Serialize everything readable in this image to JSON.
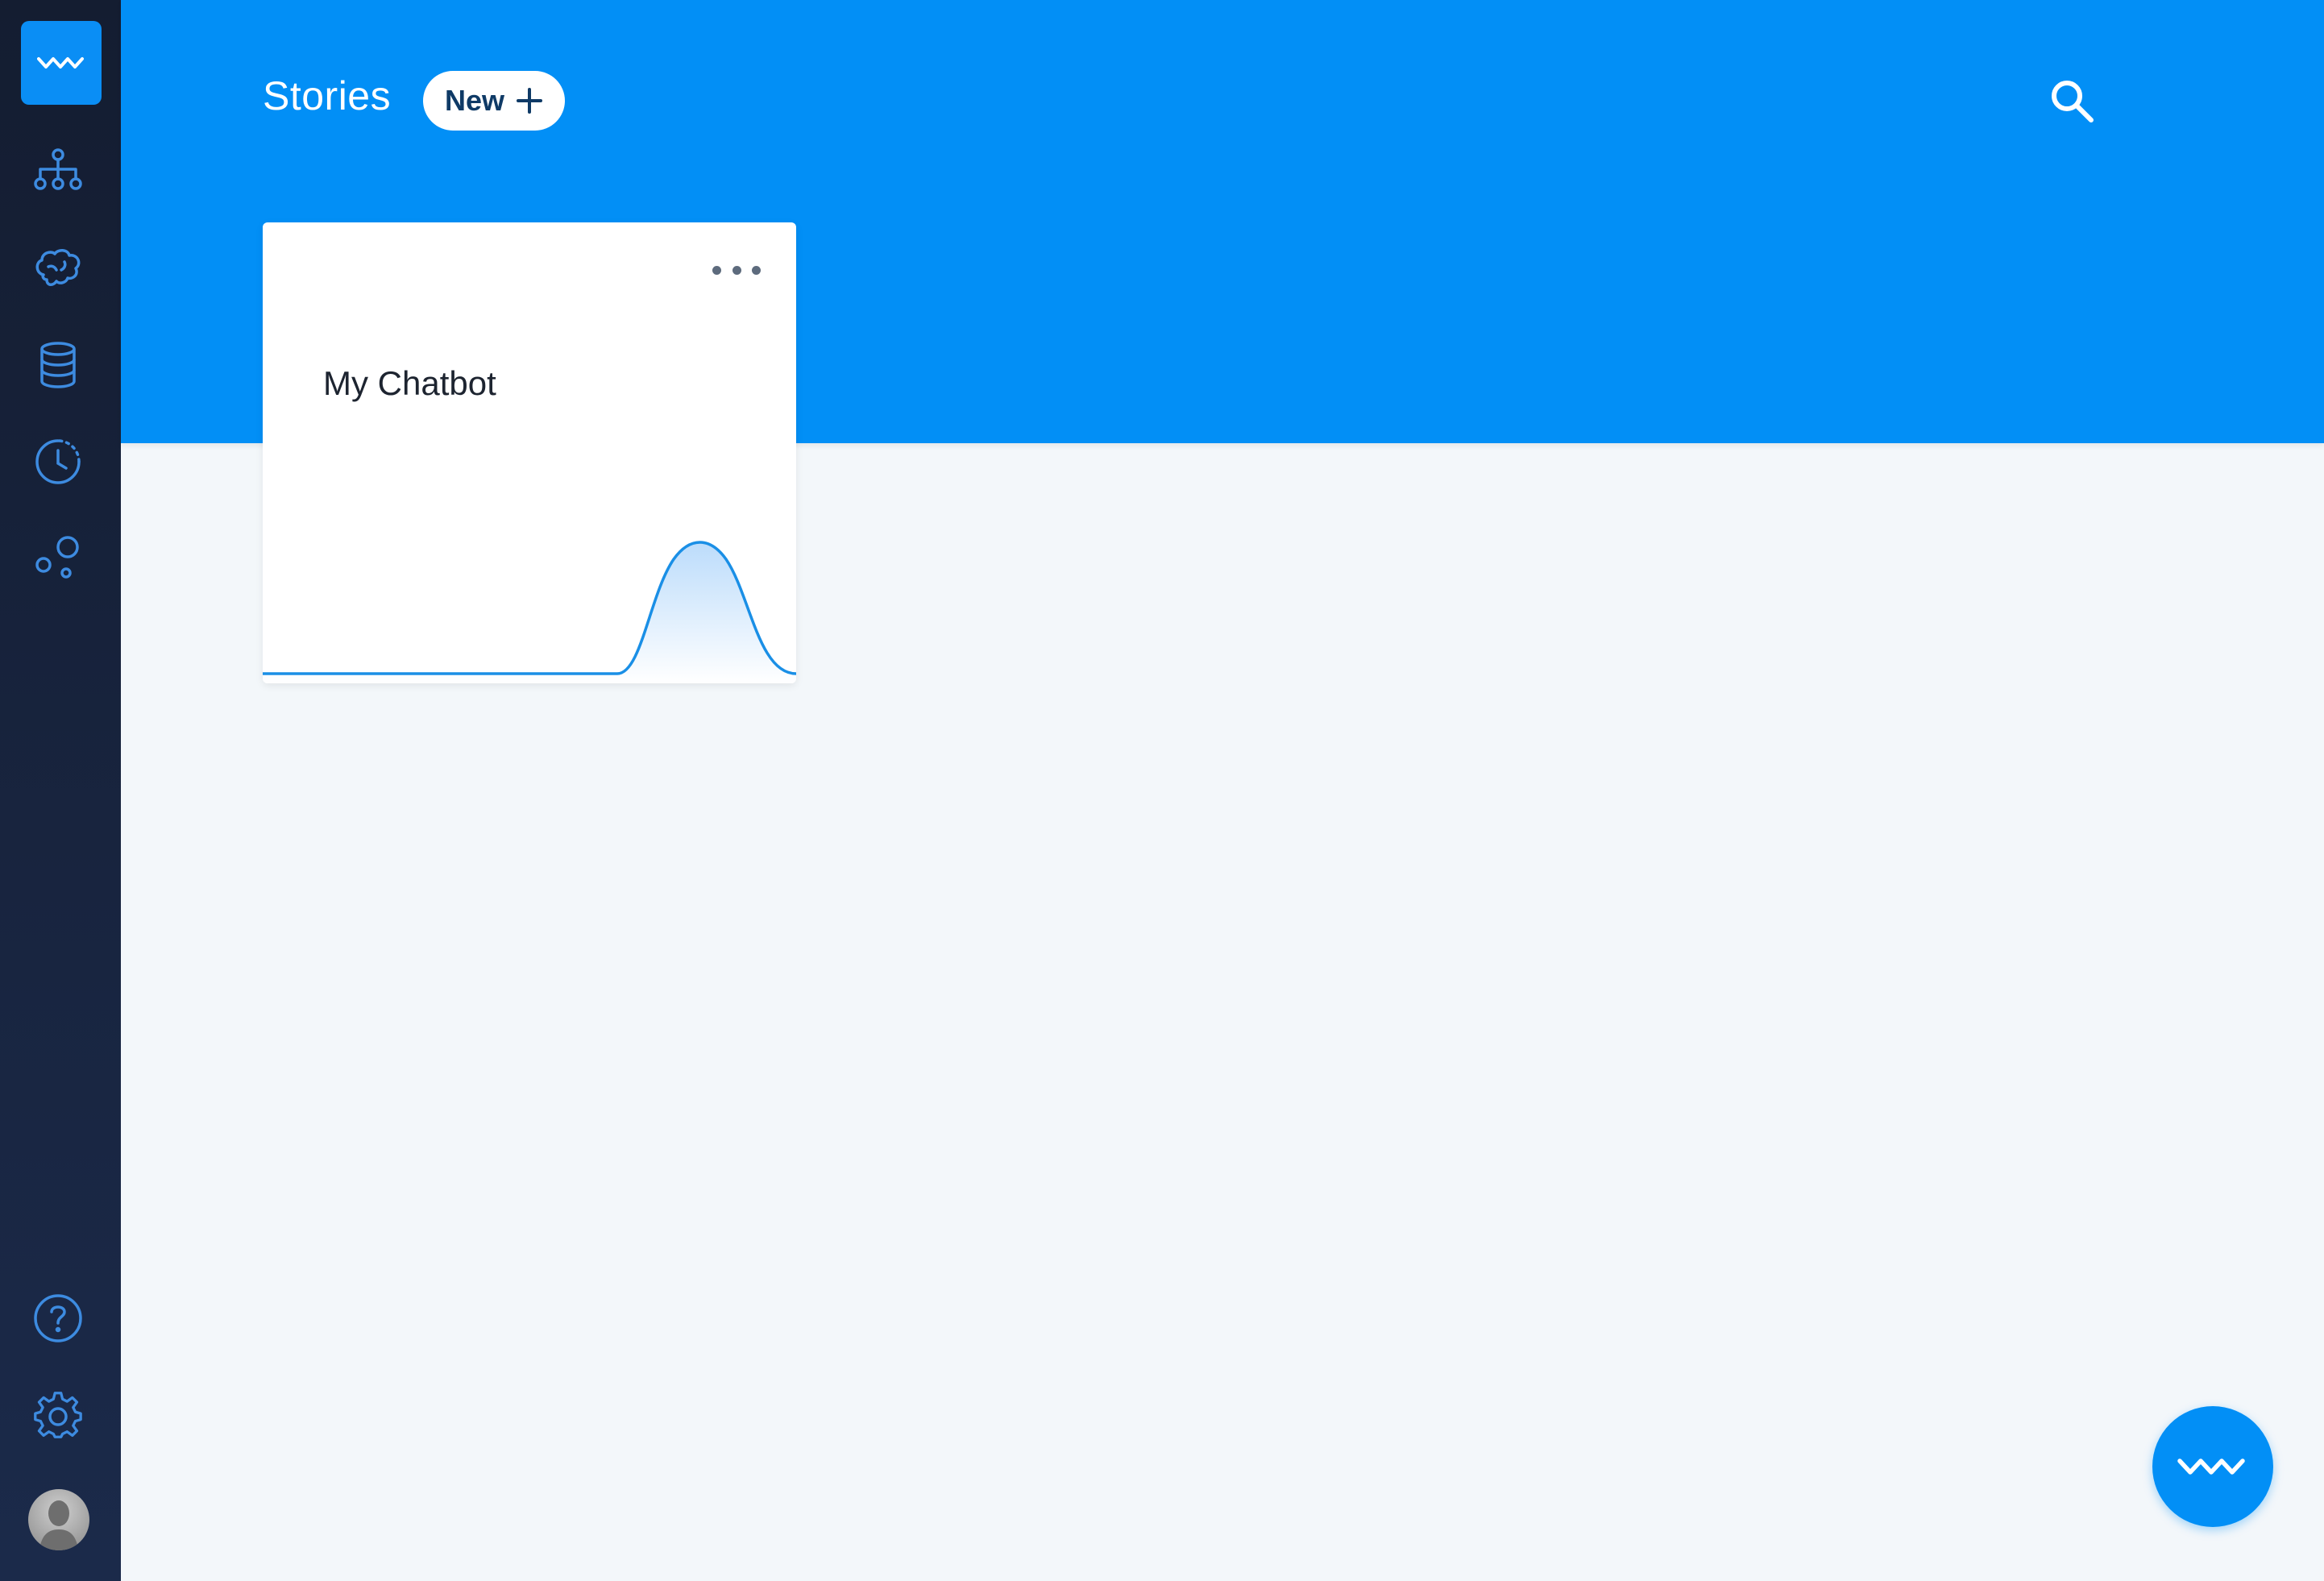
{
  "sidebar": {
    "logo_icon": "wave-logo-icon",
    "items": [
      {
        "icon": "sitemap-icon"
      },
      {
        "icon": "brain-icon"
      },
      {
        "icon": "database-icon"
      },
      {
        "icon": "history-clock-icon"
      },
      {
        "icon": "bubbles-icon"
      }
    ],
    "bottom": [
      {
        "icon": "help-icon"
      },
      {
        "icon": "gear-icon"
      }
    ]
  },
  "header": {
    "title": "Stories",
    "new_button_label": "New",
    "search_icon": "search-icon"
  },
  "stories": [
    {
      "title": "My Chatbot",
      "menu_icon": "more-dots-icon"
    }
  ],
  "fab_icon": "wave-logo-icon",
  "colors": {
    "accent": "#028ff6",
    "sidebar": "#141d31",
    "background": "#f3f7fa",
    "sidebar_icon": "#3d8be0"
  }
}
